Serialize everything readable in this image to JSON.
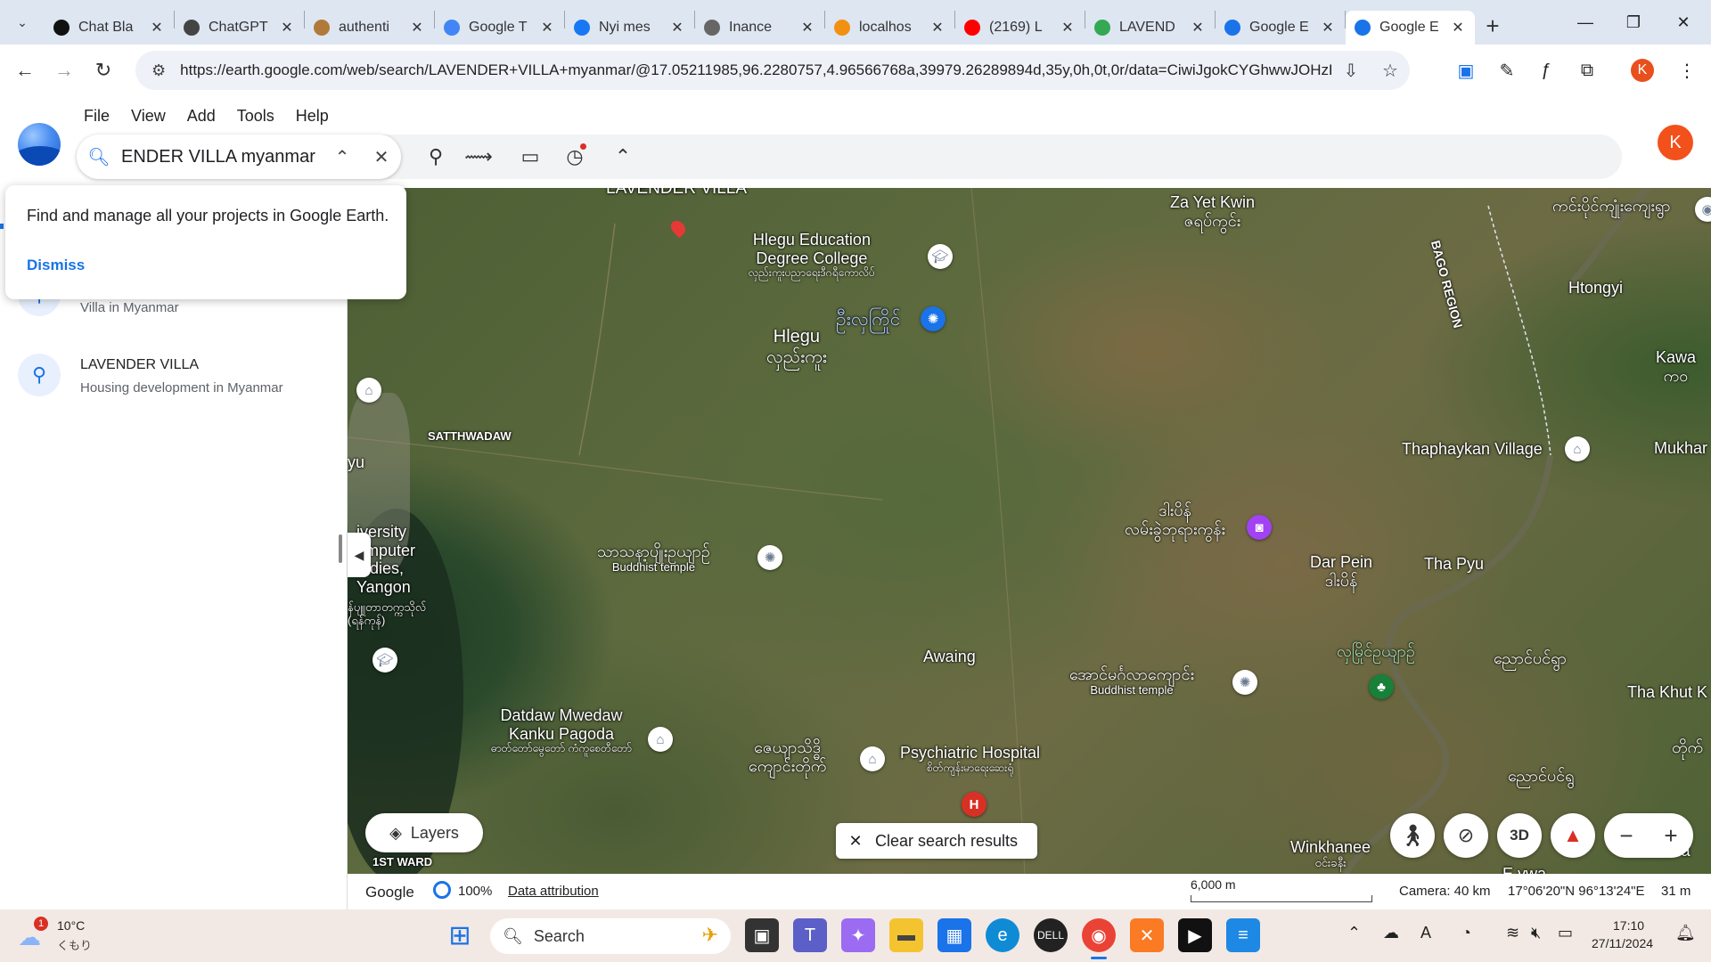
{
  "browser": {
    "tabs": [
      {
        "title": "Chat Bla",
        "icon": "chatbot-icon",
        "color": "#111"
      },
      {
        "title": "ChatGPT",
        "icon": "openai-icon",
        "color": "#444"
      },
      {
        "title": "authenti",
        "icon": "pen-icon",
        "color": "#b07a3a"
      },
      {
        "title": "Google T",
        "icon": "google-translate-icon",
        "color": "#4285f4"
      },
      {
        "title": "Nyi mes",
        "icon": "facebook-icon",
        "color": "#1877f2"
      },
      {
        "title": "Inance",
        "icon": "globe-icon",
        "color": "#666"
      },
      {
        "title": "localhos",
        "icon": "phpmyadmin-icon",
        "color": "#f29111"
      },
      {
        "title": "(2169) L",
        "icon": "youtube-icon",
        "color": "#ff0000"
      },
      {
        "title": "LAVEND",
        "icon": "maps-pin-icon",
        "color": "#34a853"
      },
      {
        "title": "Google E",
        "icon": "google-earth-icon",
        "color": "#1a73e8"
      },
      {
        "title": "Google E",
        "icon": "google-earth-icon",
        "color": "#1a73e8"
      }
    ],
    "url": "https://earth.google.com/web/search/LAVENDER+VILLA+myanmar/@17.05211985,96.2280757,4.96566768a,39979.26289894d,35y,0h,0t,0r/data=CiwiJgokCYGhwwJOHzF...",
    "profile_initial": "K"
  },
  "earth": {
    "menu": [
      "File",
      "View",
      "Add",
      "Tools",
      "Help"
    ],
    "search_text": "ENDER VILLA myanmar",
    "avatar_initial": "K",
    "popover": {
      "text": "Find and manage all your projects in Google Earth.",
      "dismiss": "Dismiss"
    },
    "results": [
      {
        "name": "",
        "desc": "Villa in Myanmar"
      },
      {
        "name": "LAVENDER VILLA",
        "desc": "Housing development in Myanmar"
      }
    ],
    "map_labels": {
      "lavender": "LAVENDER VILLA",
      "hlegu_college_1": "Hlegu Education",
      "hlegu_college_2": "Degree College",
      "hlegu_college_my": "လှည်းကူးပညာရေးဒီဂရီကောလိပ်",
      "blue_my": "ဦးလှကြိုင်",
      "hlegu": "Hlegu",
      "hlegu_my": "လှည်းကူး",
      "zayetkwin": "Za Yet Kwin",
      "zayetkwin_my": "ဇရပ်ကွင်း",
      "bago": "BAGO REGION",
      "top_right_my": "ကင်းပိုင်ကျုံးကျေးရွာ",
      "htongyi": "Htongyi",
      "kawa": "Kawa",
      "kawa_my": "ကဝ",
      "mukhar": "Mukhar",
      "thaphaykan": "Thaphaykan Village",
      "satthwadaw": "SATTHWADAW",
      "yu": "yu",
      "university_1": "iversity",
      "university_2": "omputer",
      "university_3": "tudies,",
      "university_4": "Yangon",
      "university_my": "န်ပျူတာတက္ကသိုလ်",
      "university_my2": "(ရန်ကုန်)",
      "buddhist1_my": "သာသနာ့ပျိုးဥယျာဉ်",
      "buddhist1": "Buddhist temple",
      "dapein_my_1": "ဒါးပိန်",
      "dapein_my_2": "လမ်းခွဲဘုရားကွန်း",
      "darpein": "Dar Pein",
      "darpein_my": "ဒါးပိန်",
      "thapyu": "Tha Pyu",
      "awaing": "Awaing",
      "buddhist2_my": "အောင်မင်္ဂလာကျောင်း",
      "buddhist2": "Buddhist temple",
      "green_my": "လှမြိုင်ဥယျာဉ်",
      "right_my": "ညောင်ပင်ရွာ",
      "thakhut": "Tha Khut K",
      "datdaw_1": "Datdaw Mwedaw",
      "datdaw_2": "Kanku Pagoda",
      "datdaw_my": "ဓာတ်တော်မွေတော် ကံကူစေတီတော်",
      "pagoda2_my_1": "ဇေယျာသိဒ္ဓိ",
      "pagoda2_my_2": "ကျောင်းတိုက်",
      "psych": "Psychiatric Hospital",
      "psych_my": "စိတ်ကျန်းမာရေးဆေးရုံ",
      "right2_my": "ညောင်ပင်ရွ",
      "right3_my": "တိုက်",
      "winkhanee": "Winkhanee",
      "winkhanee_my": "ဝင်းခနီး",
      "eywa": "E ywa",
      "firstward": "1ST WARD",
      "ya": "Ya"
    },
    "controls": {
      "layers": "Layers",
      "clear": "Clear search results",
      "threed": "3D"
    },
    "status": {
      "google": "Google",
      "zoom": "100%",
      "attribution": "Data attribution",
      "scale": "6,000 m",
      "camera": "Camera: 40 km",
      "coords": "17°06'20\"N 96°13'24\"E",
      "elevation": "31 m"
    }
  },
  "taskbar": {
    "weather_temp": "10°C",
    "weather_desc": "くもり",
    "weather_badge": "1",
    "search_label": "Search",
    "time": "17:10",
    "date": "27/11/2024"
  }
}
